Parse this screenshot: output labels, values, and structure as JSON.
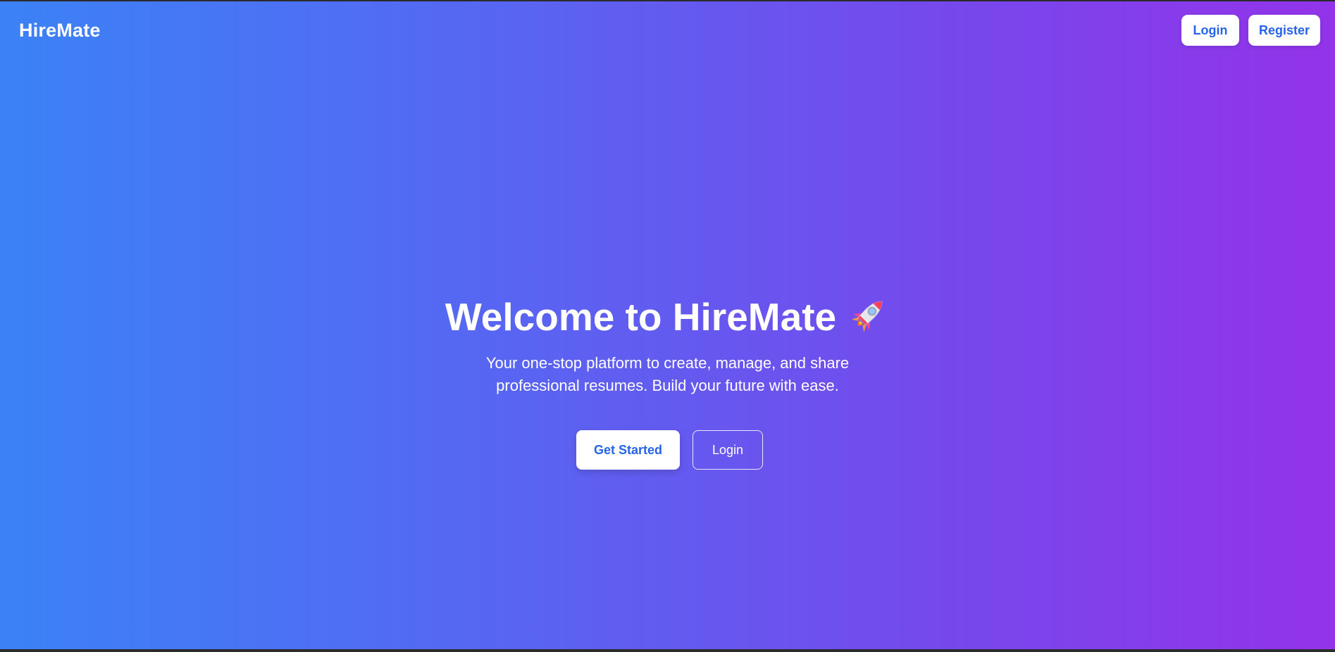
{
  "navbar": {
    "brand": "HireMate",
    "login_label": "Login",
    "register_label": "Register"
  },
  "hero": {
    "title": "Welcome to HireMate",
    "title_icon": "rocket-icon",
    "subtitle_line1": "Your one-stop platform to create, manage, and share",
    "subtitle_line2": "professional resumes. Build your future with ease.",
    "primary_button": "Get Started",
    "secondary_button": "Login"
  },
  "colors": {
    "gradient_start": "#3b82f6",
    "gradient_end": "#9333ea",
    "button_text": "#2563eb"
  }
}
